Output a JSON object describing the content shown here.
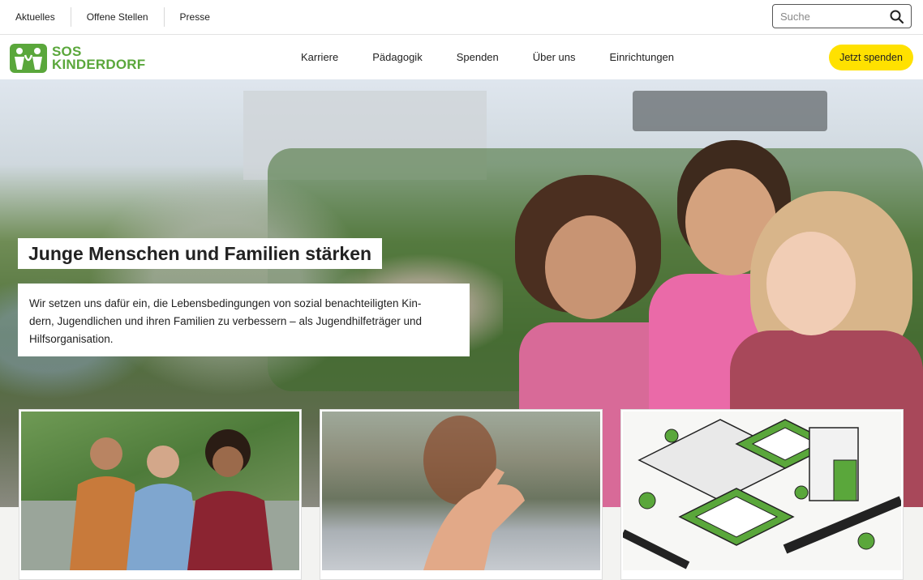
{
  "topbar": {
    "links": [
      "Aktuelles",
      "Offene Stellen",
      "Presse"
    ],
    "search_placeholder": "Suche"
  },
  "header": {
    "logo_line1": "SOS",
    "logo_line2": "KINDERDORF",
    "nav": [
      "Karriere",
      "Pädagogik",
      "Spenden",
      "Über uns",
      "Einrichtungen"
    ],
    "donate_label": "Jetzt spenden"
  },
  "hero": {
    "title": "Junge Menschen und Familien stärken",
    "text_lines": [
      "Wir setzen uns dafür ein, die Lebensbedingungen von sozial benachteiligten Kin-",
      "dern, Jugendlichen und ihren Familien zu verbessern – als Jugendhilfeträger und",
      "Hilfsorganisation."
    ]
  },
  "colors": {
    "brand_green": "#5aa73b",
    "donate_yellow": "#ffe100"
  },
  "icons": {
    "search": "search-icon",
    "logo": "sos-kinderdorf-logo-icon"
  }
}
